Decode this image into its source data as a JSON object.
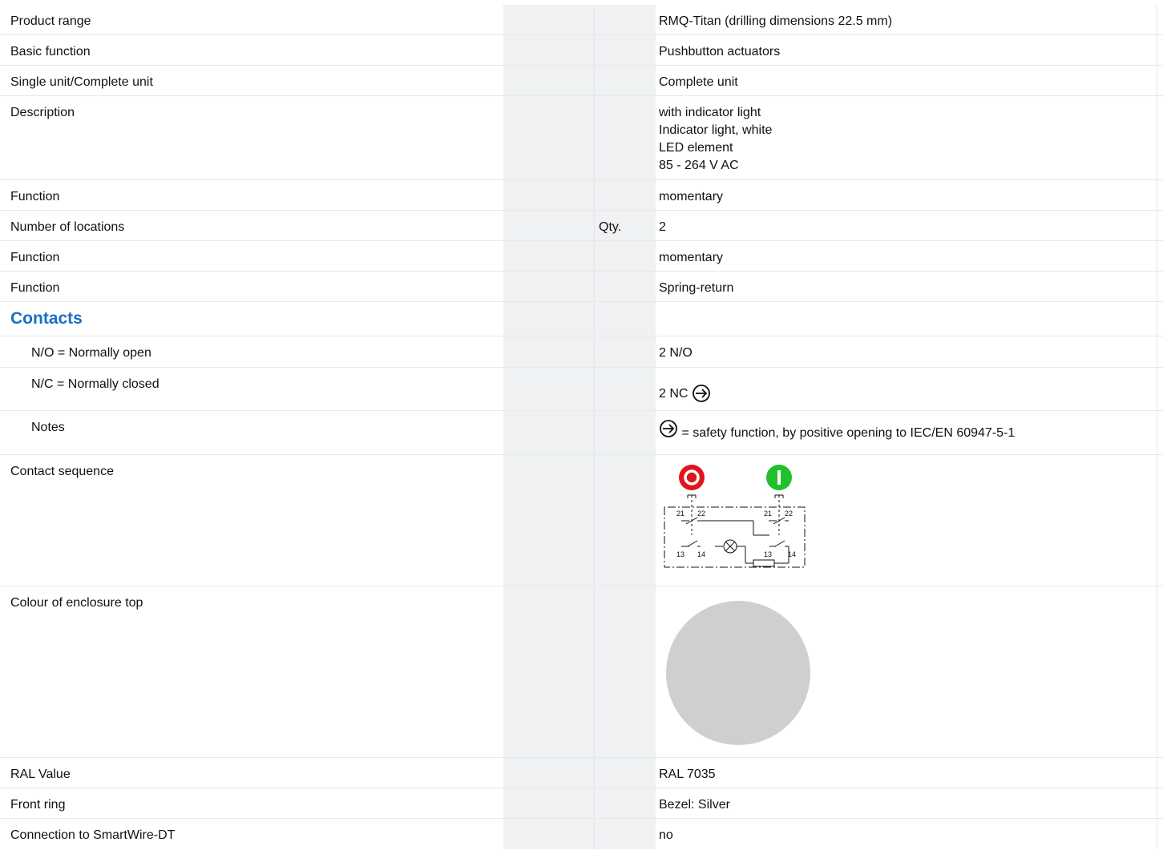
{
  "colors": {
    "accent": "#1a6fc4",
    "shaded_column": "#eff1f3",
    "enclosure_top": "#cfcfcf",
    "off_button": "#e1141c",
    "on_button": "#22c02d"
  },
  "rows": {
    "product_range": {
      "label": "Product range",
      "value": "RMQ-Titan (drilling dimensions 22.5 mm)"
    },
    "basic_function": {
      "label": "Basic function",
      "value": "Pushbutton actuators"
    },
    "single_complete": {
      "label": "Single unit/Complete unit",
      "value": "Complete unit"
    },
    "description": {
      "label": "Description",
      "lines": [
        "with indicator light",
        "Indicator light, white",
        "LED element",
        "85 - 264 V AC"
      ]
    },
    "function_1": {
      "label": "Function",
      "value": "momentary"
    },
    "locations": {
      "label": "Number of locations",
      "unit": "Qty.",
      "value": "2"
    },
    "function_2": {
      "label": "Function",
      "value": "momentary"
    },
    "function_3": {
      "label": "Function",
      "value": "Spring-return"
    },
    "contacts": {
      "title": "Contacts"
    },
    "no": {
      "label": "N/O = Normally open",
      "value": "2 N/O"
    },
    "nc": {
      "label": "N/C = Normally closed",
      "value": "2 NC",
      "icon": "positive-opening-icon"
    },
    "notes": {
      "label": "Notes",
      "value": "= safety function, by positive opening to IEC/EN 60947-5-1",
      "icon": "positive-opening-icon"
    },
    "contact_sequence": {
      "label": "Contact sequence",
      "diagram_labels": {
        "t21": "21",
        "t22": "22",
        "t13": "13",
        "t14": "14",
        "off_symbol": "O",
        "on_symbol": "I"
      }
    },
    "enclosure_colour": {
      "label": "Colour of enclosure top"
    },
    "ral": {
      "label": "RAL Value",
      "value": "RAL 7035"
    },
    "front_ring": {
      "label": "Front ring",
      "value": "Bezel: Silver"
    },
    "smartwire": {
      "label": "Connection to SmartWire-DT",
      "value": "no"
    }
  }
}
